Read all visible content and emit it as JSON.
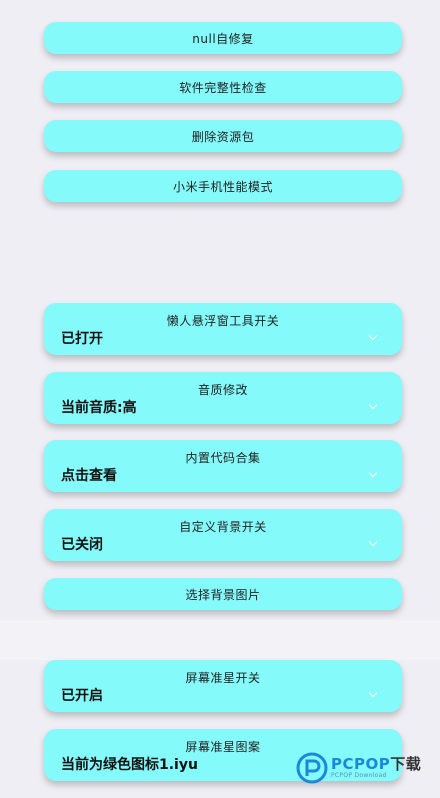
{
  "buttons": {
    "null_repair": "null自修复",
    "integrity_check": "软件完整性检查",
    "delete_resource_pack": "删除资源包",
    "xiaomi_performance": "小米手机性能模式",
    "choose_bg_image": "选择背景图片"
  },
  "selects": {
    "lazy_float_tool": {
      "title": "懒人悬浮窗工具开关",
      "value": "已打开"
    },
    "audio_quality": {
      "title": "音质修改",
      "value": "当前音质:高"
    },
    "builtin_codes": {
      "title": "内置代码合集",
      "value": "点击查看"
    },
    "custom_bg": {
      "title": "自定义背景开关",
      "value": "已关闭"
    },
    "crosshair_switch": {
      "title": "屏幕准星开关",
      "value": "已开启"
    },
    "crosshair_pattern": {
      "title": "屏幕准星图案",
      "value": "当前为绿色图标1.iyu"
    }
  },
  "watermark": {
    "brand": "PCPOP",
    "suffix": "下载",
    "tagline": "PCPOP Download",
    "color": "#1e88d6"
  },
  "theme": {
    "accent": "#84fafa",
    "background": "#eeeef4"
  }
}
